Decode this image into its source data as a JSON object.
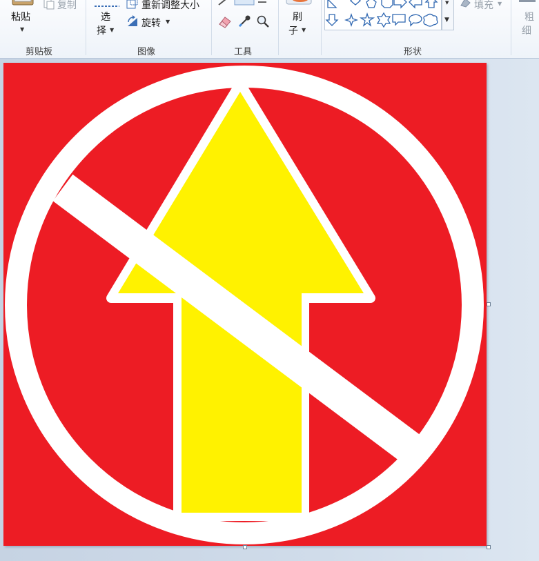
{
  "ribbon": {
    "clipboard": {
      "paste_label": "粘贴",
      "copy_label": "复制",
      "group_label": "剪贴板"
    },
    "image": {
      "select_label_1": "选",
      "select_label_2": "择",
      "resize_label": "重新调整大小",
      "rotate_label": "旋转",
      "group_label": "图像"
    },
    "tools": {
      "group_label": "工具"
    },
    "brush": {
      "label_1": "刷",
      "label_2": "子"
    },
    "shapes": {
      "fill_label": "填充",
      "group_label": "形状"
    },
    "size": {
      "label_1": "粗",
      "label_2": "细"
    }
  },
  "colors": {
    "sign_red": "#ed1c24",
    "arrow_yellow": "#fff200",
    "white": "#ffffff"
  },
  "canvas": {
    "content": "no-entry style prohibition sign with yellow up arrow"
  }
}
